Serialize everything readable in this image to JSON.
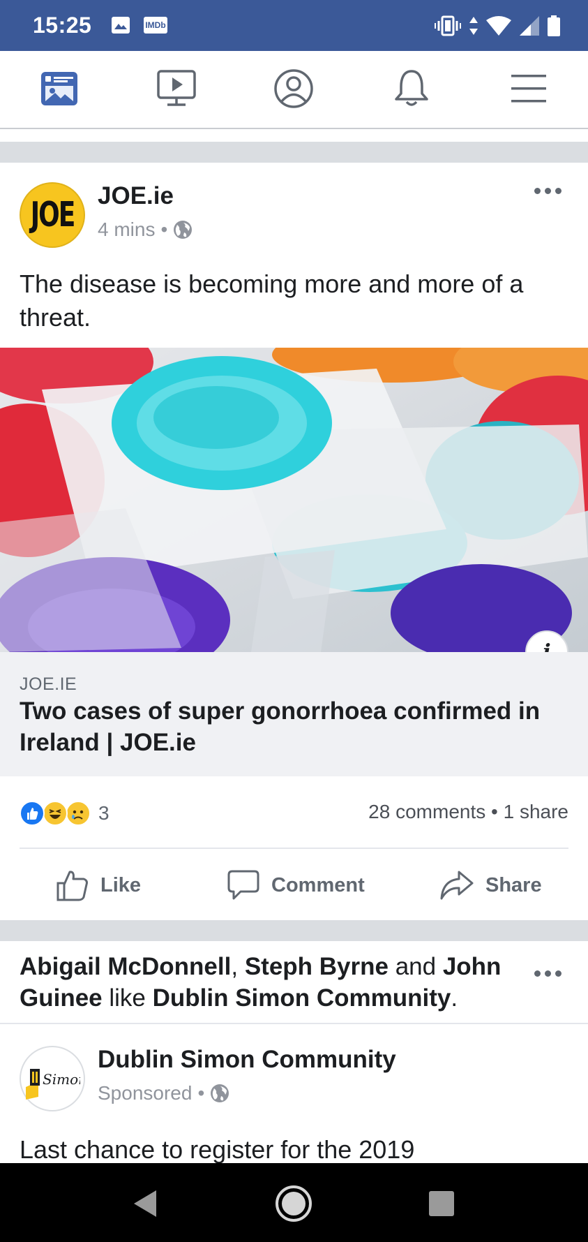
{
  "status_bar": {
    "time": "15:25",
    "imdb_label": "IMDb",
    "icons": [
      "gallery-icon",
      "imdb-icon",
      "vibrate-icon",
      "data-arrows-icon",
      "wifi-icon",
      "signal-icon",
      "battery-icon"
    ],
    "bg_color": "#3b5998"
  },
  "nav": {
    "items": [
      "news-feed-icon",
      "watch-icon",
      "profile-icon",
      "notifications-icon",
      "menu-icon"
    ],
    "active": "news-feed-icon",
    "accent": "#4267b2"
  },
  "post1": {
    "page_name": "JOE.ie",
    "avatar_text": "JOE",
    "time": "4 mins",
    "separator": "•",
    "privacy": "globe-icon",
    "text": "The disease is becoming more and more of a threat.",
    "link": {
      "domain": "JOE.IE",
      "title": "Two cases of super gonorrhoea confirmed in Ireland | JOE.ie",
      "info": "i"
    },
    "reactions": {
      "types": [
        "like",
        "haha",
        "sad"
      ],
      "count": "3"
    },
    "engagement": "28 comments • 1 share",
    "actions": {
      "like": "Like",
      "comment": "Comment",
      "share": "Share"
    }
  },
  "post2": {
    "social_context": {
      "name1": "Abigail McDonnell",
      "comma": ", ",
      "name2": "Steph Byrne",
      "and": " and ",
      "name3": "John Guinee",
      "like": " like ",
      "page": "Dublin Simon Community",
      "period": "."
    },
    "page_name": "Dublin Simon Community",
    "avatar_text": "Simon",
    "sponsored": "Sponsored",
    "separator": "•",
    "text": "Last chance to register for the 2019"
  },
  "system_nav": [
    "back-icon",
    "home-icon",
    "recents-icon"
  ]
}
